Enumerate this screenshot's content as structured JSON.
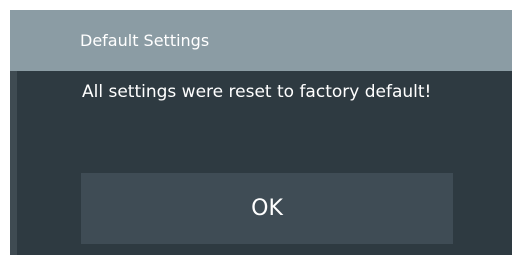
{
  "dialog": {
    "title": "Default Settings",
    "message": "All settings were reset to factory default!",
    "ok_label": "OK"
  },
  "colors": {
    "title_bar": "#8b9ca4",
    "dialog_body": "#2e3a41",
    "button": "#3f4c55",
    "text": "#ffffff"
  }
}
